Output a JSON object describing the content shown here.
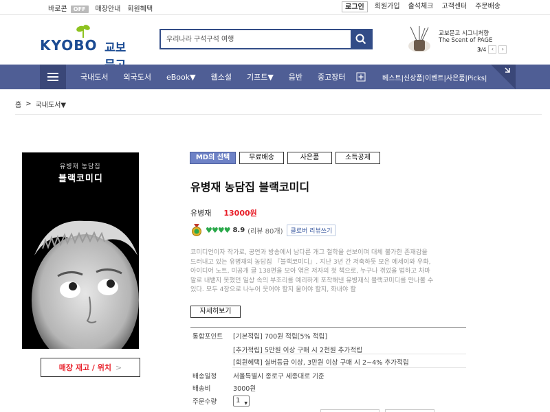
{
  "topbar": {
    "barocon_label": "바로콘",
    "barocon_state": "OFF",
    "store_guide": "매장안내",
    "member_benefits": "회원혜택",
    "login": "로그인",
    "signup": "회원가입",
    "attendance": "출석체크",
    "customer_center": "고객센터",
    "order_delivery": "주문배송"
  },
  "brand": {
    "logo_en": "KYOBO",
    "logo_ko": "교보문고",
    "brand_color": "#1b4b93"
  },
  "search": {
    "placeholder": "우리나라 구석구석 여행"
  },
  "promo": {
    "line1": "교보문고 시그니처향",
    "line2": "The Scent of PAGE",
    "page_current": "3",
    "page_total": "/4",
    "prev": "‹",
    "next": "›"
  },
  "nav": {
    "items": [
      "국내도서",
      "외국도서",
      "eBook▼",
      "웹소설",
      "기프트▼",
      "음반",
      "중고장터"
    ],
    "plus": "+",
    "links": "베스트|신상품|이벤트|사은품|Picks|",
    "bg_color": "#4f5e95"
  },
  "breadcrumb": {
    "home": "홈",
    "sep": ">",
    "category": "국내도서▼"
  },
  "book": {
    "cover_subtitle": "유병재 농담집",
    "cover_title": "블랙코미디",
    "tags": [
      "MD의 선택",
      "무료배송",
      "사은품",
      "소득공제"
    ],
    "title": "유병재 농담집 블랙코미디",
    "author": "유병재",
    "price": "13000원",
    "hearts": "♥♥♥♥",
    "score": "8.9",
    "review_count": "(리뷰 80개)",
    "review_button": "클로버 리뷰쓰기",
    "description": "코미디언이자 작가로, 공연과 방송에서 남다른 개그 철학을 선보이며 대체 불가한 존재감을 드러내고 있는 유병재의 농담집 『블랙코미디』. 지난 3년 간 저축하듯 모은 에세이와 우화, 아이디어 노트, 미공개 글 138편을 모아 엮은 저자의 첫 책으로, 누구나 겪었을 법하고 차마 말로 내뱉지 못했던 일상 속의 부조리를 예리하게 포착해낸 유병재식 블랙코미디를 만나볼 수 있다. 모두 4장으로 나누어 웃어야 할지 울어야 할지, 화내야 할",
    "more_button": "자세히보기",
    "stock_button": "매장 재고 / 위치",
    "stock_arrow": ">",
    "accent_color": "#e8202a"
  },
  "info": {
    "points_label": "통합포인트",
    "points_basic": "[기본적립] 700원 적립[5% 적립]",
    "points_extra": "[추가적립] 5만원 이상 구매 시 2천원 추가적립",
    "points_member": "[회원혜택] 실버등급 이상, 3만원 이상 구매 시 2~4% 추가적립",
    "shipping_label": "배송일정",
    "shipping_value": "서울특별시 종로구 세종대로 기준",
    "fee_label": "배송비",
    "fee_value": "3000원",
    "qty_label": "주문수량",
    "qty_value": "1"
  }
}
